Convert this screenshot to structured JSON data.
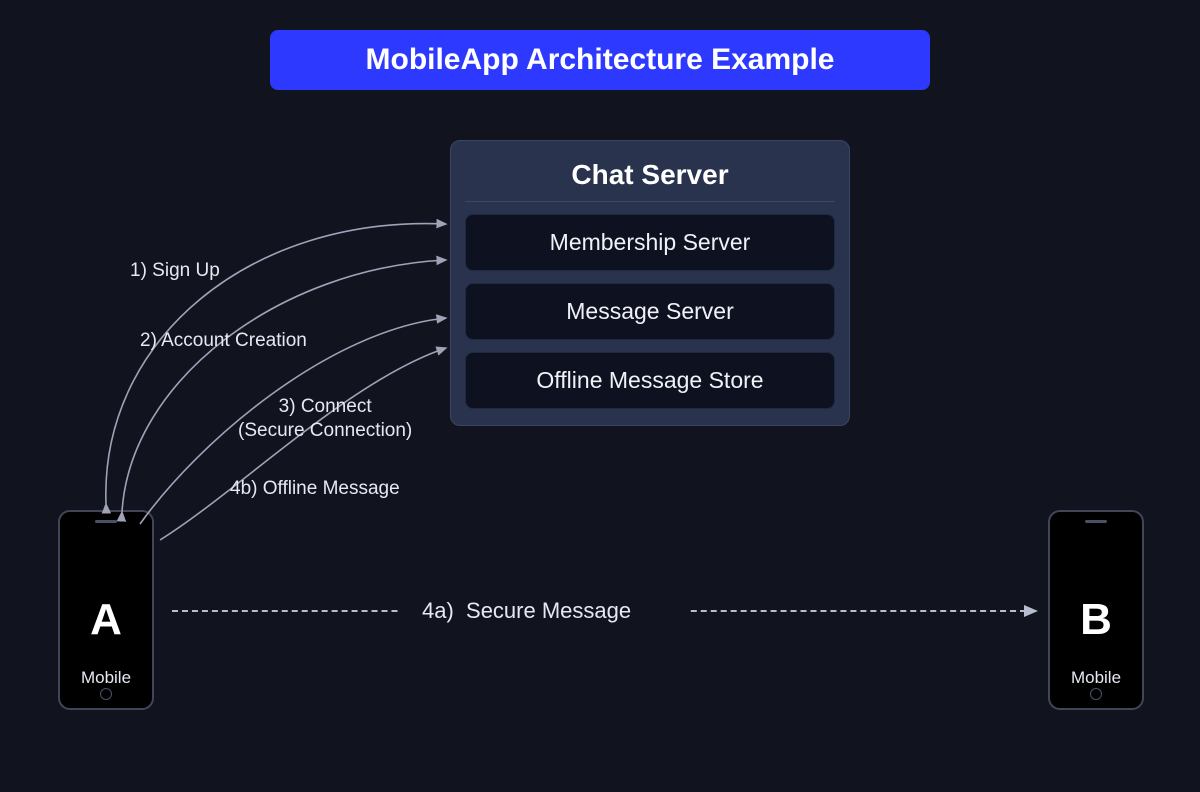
{
  "title": "MobileApp Architecture Example",
  "server": {
    "title": "Chat Server",
    "items": {
      "membership": "Membership Server",
      "message": "Message Server",
      "offline_store": "Offline Message Store"
    }
  },
  "nodes": {
    "phone_a_letter": "A",
    "phone_a_label": "Mobile",
    "phone_b_letter": "B",
    "phone_b_label": "Mobile"
  },
  "flows": {
    "f1": "1) Sign Up",
    "f2": "2) Account Creation",
    "f3": "3) Connect\n(Secure Connection)",
    "f4b": "4b) Offline Message",
    "f4a": "4a)  Secure Message"
  },
  "colors": {
    "background": "#11131f",
    "accent": "#2d39ff",
    "server_bg": "#29334e",
    "item_bg": "#0e1220",
    "arrow": "#9ea3b8"
  }
}
